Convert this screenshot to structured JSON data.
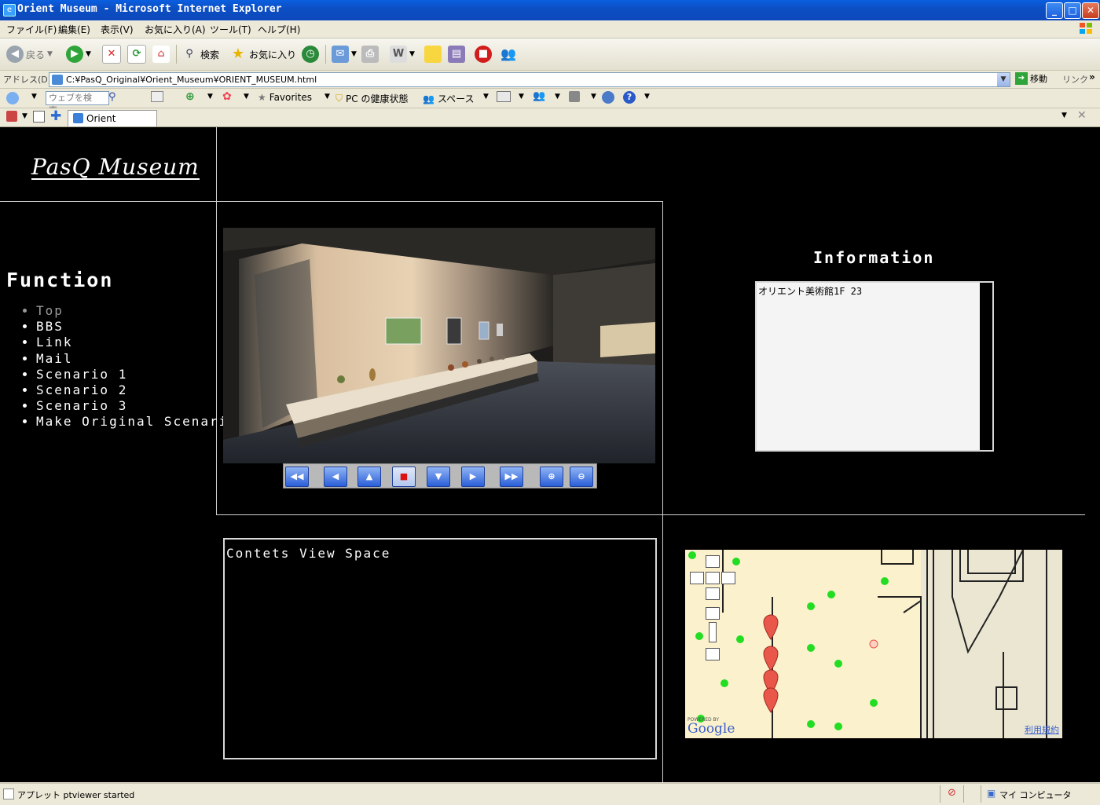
{
  "window": {
    "title": "Orient Museum - Microsoft Internet Explorer",
    "min": "_",
    "max": "□",
    "close": "✕"
  },
  "menu": [
    "ファイル(F)",
    "編集(E)",
    "表示(V)",
    "お気に入り(A)",
    "ツール(T)",
    "ヘルプ(H)"
  ],
  "toolbar": {
    "back": "戻る",
    "search": "検索",
    "favorites": "お気に入り"
  },
  "address": {
    "label": "アドレス(D)",
    "url": "C:¥PasQ_Original¥Orient_Museum¥ORIENT_MUSEUM.html",
    "go": "移動",
    "links": "リンク"
  },
  "linkbar": {
    "search_placeholder": "ウェブを検索...",
    "favorites": "Favorites",
    "health": "PC の健康状態",
    "spaces": "スペース"
  },
  "tab": {
    "title": "Orient Museum"
  },
  "page": {
    "logo": "PasQ Museum",
    "function_title": "Function",
    "function_items": [
      "Top",
      "BBS",
      "Link",
      "Mail",
      "Scenario 1",
      "Scenario 2",
      "Scenario 3",
      "Make Original Scenario"
    ],
    "info_title": "Information",
    "info_text": "オリエント美術館1F 23",
    "contents_text": "Contets View Space",
    "map_powered": "POWERED BY",
    "map_brand": "Google",
    "map_terms": "利用規約"
  },
  "status": {
    "text": "アプレット ptviewer started",
    "zone": "マイ コンピュータ"
  },
  "colors": {
    "titlebar": "#0a5fe0",
    "content_bg": "#000000",
    "map_bg": "#fbf1cc",
    "marker_green": "#22dd22",
    "marker_red": "#e8574a"
  }
}
